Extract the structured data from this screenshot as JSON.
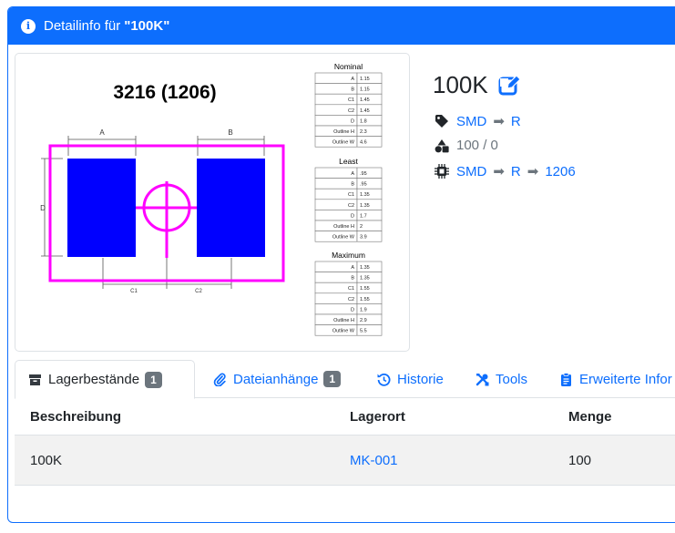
{
  "header": {
    "prefix": "Detailinfo für",
    "part_quoted": "\"100K\""
  },
  "footprint_image": {
    "title": "3216 (1206)",
    "dim_labels": {
      "a": "A",
      "b": "B",
      "d": "D",
      "c1": "C1",
      "c2": "C2"
    },
    "tables": [
      {
        "title": "Nominal",
        "rows": [
          [
            "A",
            "1.15"
          ],
          [
            "B",
            "1.15"
          ],
          [
            "C1",
            "1.45"
          ],
          [
            "C2",
            "1.45"
          ],
          [
            "D",
            "1.8"
          ],
          [
            "Outline H",
            "2.3"
          ],
          [
            "Outline W",
            "4.6"
          ]
        ]
      },
      {
        "title": "Least",
        "rows": [
          [
            "A",
            ".95"
          ],
          [
            "B",
            ".95"
          ],
          [
            "C1",
            "1.35"
          ],
          [
            "C2",
            "1.35"
          ],
          [
            "D",
            "1.7"
          ],
          [
            "Outline H",
            "2"
          ],
          [
            "Outline W",
            "3.9"
          ]
        ]
      },
      {
        "title": "Maximum",
        "rows": [
          [
            "A",
            "1.35"
          ],
          [
            "B",
            "1.35"
          ],
          [
            "C1",
            "1.55"
          ],
          [
            "C2",
            "1.55"
          ],
          [
            "D",
            "1.9"
          ],
          [
            "Outline H",
            "2.9"
          ],
          [
            "Outline W",
            "5.5"
          ]
        ]
      }
    ]
  },
  "part": {
    "name": "100K",
    "category": [
      "SMD",
      "R"
    ],
    "stock": "100 / 0",
    "footprint": [
      "SMD",
      "R",
      "1206"
    ]
  },
  "tabs": [
    {
      "label": "Lagerbestände",
      "badge": "1",
      "icon": "box-icon"
    },
    {
      "label": "Dateianhänge",
      "badge": "1",
      "icon": "paperclip-icon"
    },
    {
      "label": "Historie",
      "icon": "history-icon"
    },
    {
      "label": "Tools",
      "icon": "tools-icon"
    },
    {
      "label": "Erweiterte Infor",
      "icon": "clipboard-icon"
    }
  ],
  "table": {
    "headers": [
      "Beschreibung",
      "Lagerort",
      "Menge"
    ],
    "rows": [
      {
        "description": "100K",
        "location": "MK-001",
        "amount": "100"
      }
    ]
  },
  "colors": {
    "primary": "#0d6efd",
    "pad": "#0000ff",
    "outline": "#ff00ff",
    "badge": "#6c757d"
  }
}
